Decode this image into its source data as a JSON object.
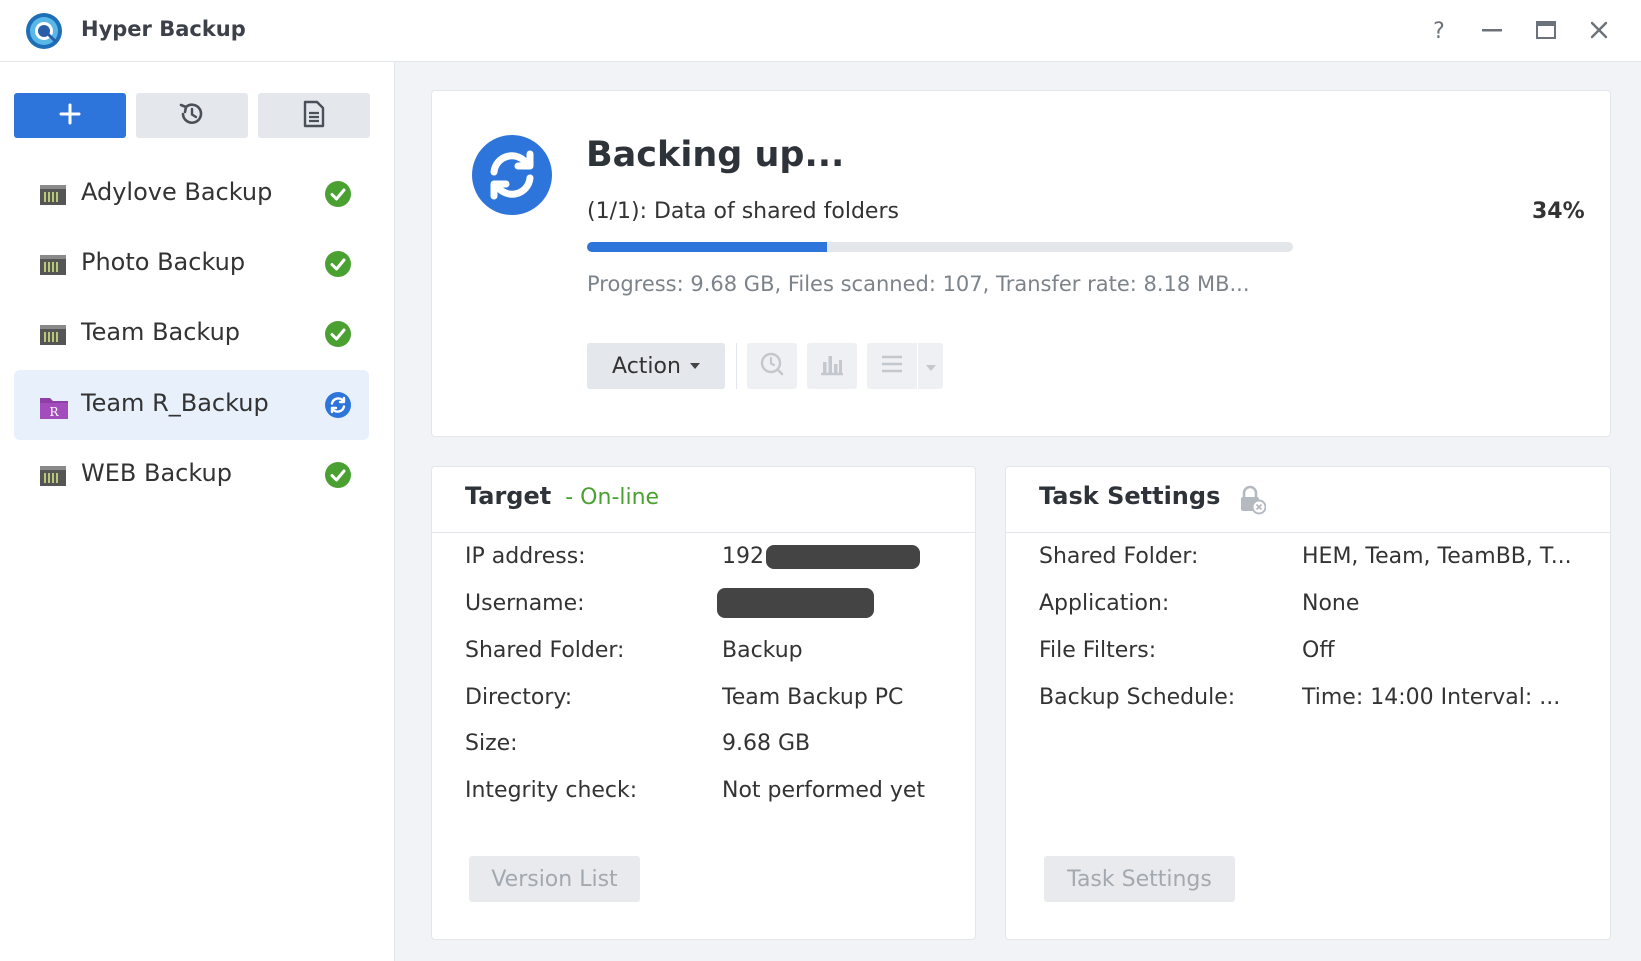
{
  "app": {
    "title": "Hyper Backup",
    "icons": {
      "logo": "hyper-backup-logo",
      "help": "help-icon",
      "minimize": "minimize-icon",
      "maximize": "maximize-icon",
      "close": "close-icon"
    }
  },
  "toolbar": {
    "add": "plus-icon",
    "history": "restore-history-icon",
    "log": "log-document-icon"
  },
  "tasks": [
    {
      "label": "Adylove Backup",
      "icon": "nas-icon",
      "status": "success-icon"
    },
    {
      "label": "Photo Backup",
      "icon": "nas-icon",
      "status": "success-icon"
    },
    {
      "label": "Team Backup",
      "icon": "nas-icon",
      "status": "success-icon"
    },
    {
      "label": "Team R_Backup",
      "icon": "remote-folder-icon",
      "status": "syncing-icon",
      "selected": true
    },
    {
      "label": "WEB Backup",
      "icon": "nas-icon",
      "status": "success-icon"
    }
  ],
  "status": {
    "title": "Backing up...",
    "subtitle": "(1/1): Data of shared folders",
    "percent_label": "34%",
    "progress": 0.34,
    "detail": "Progress: 9.68 GB, Files scanned: 107, Transfer rate: 8.18 MB...",
    "action_label": "Action",
    "icons": [
      "scheduled-check-icon",
      "statistics-icon",
      "list-icon",
      "dropdown-icon"
    ]
  },
  "target": {
    "title": "Target",
    "state": "- On-line",
    "rows": [
      {
        "label": "IP address:",
        "value": "192."
      },
      {
        "label": "Username:",
        "value": ""
      },
      {
        "label": "Shared Folder:",
        "value": "Backup"
      },
      {
        "label": "Directory:",
        "value": "Team Backup PC"
      },
      {
        "label": "Size:",
        "value": "9.68 GB"
      },
      {
        "label": "Integrity check:",
        "value": "Not performed yet"
      }
    ],
    "button": "Version List"
  },
  "settings": {
    "title": "Task Settings",
    "title_icon": "encryption-off-icon",
    "rows": [
      {
        "label": "Shared Folder:",
        "value": "HEM, Team, TeamBB, T..."
      },
      {
        "label": "Application:",
        "value": "None"
      },
      {
        "label": "File Filters:",
        "value": "Off"
      },
      {
        "label": "Backup Schedule:",
        "value": "Time: 14:00 Interval: ..."
      }
    ],
    "button": "Task Settings"
  },
  "colors": {
    "accent": "#2e75db",
    "success": "#4aa131",
    "online": "#4aa131",
    "folder": "#8e3fa5"
  }
}
